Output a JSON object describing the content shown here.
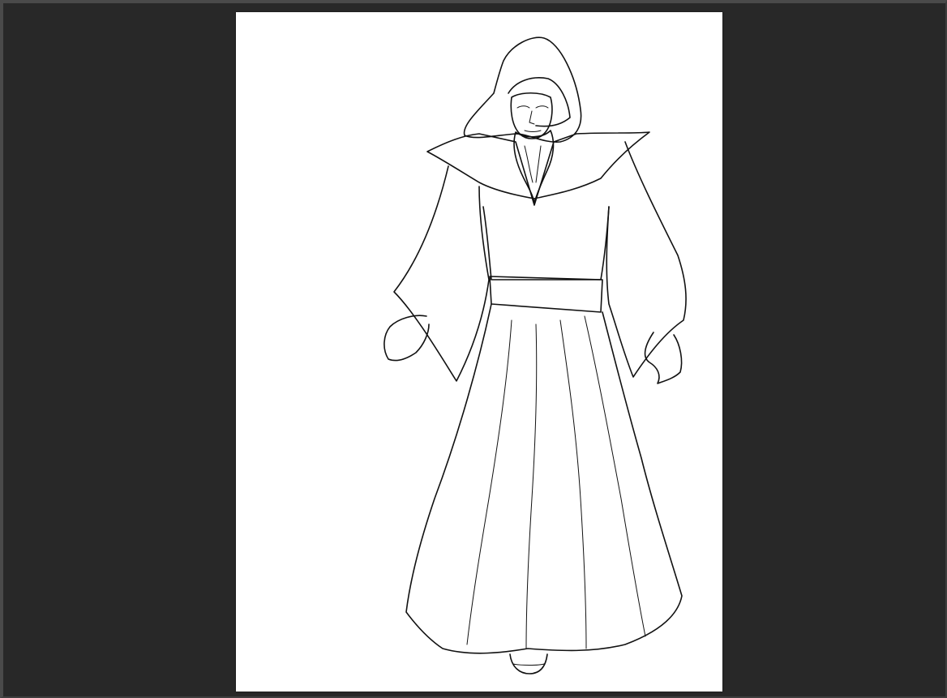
{
  "workspace": {
    "background_color": "#282828",
    "canvas_color": "#ffffff"
  },
  "canvas": {
    "artwork_subject": "line-art-hooded-wizard-figure"
  }
}
